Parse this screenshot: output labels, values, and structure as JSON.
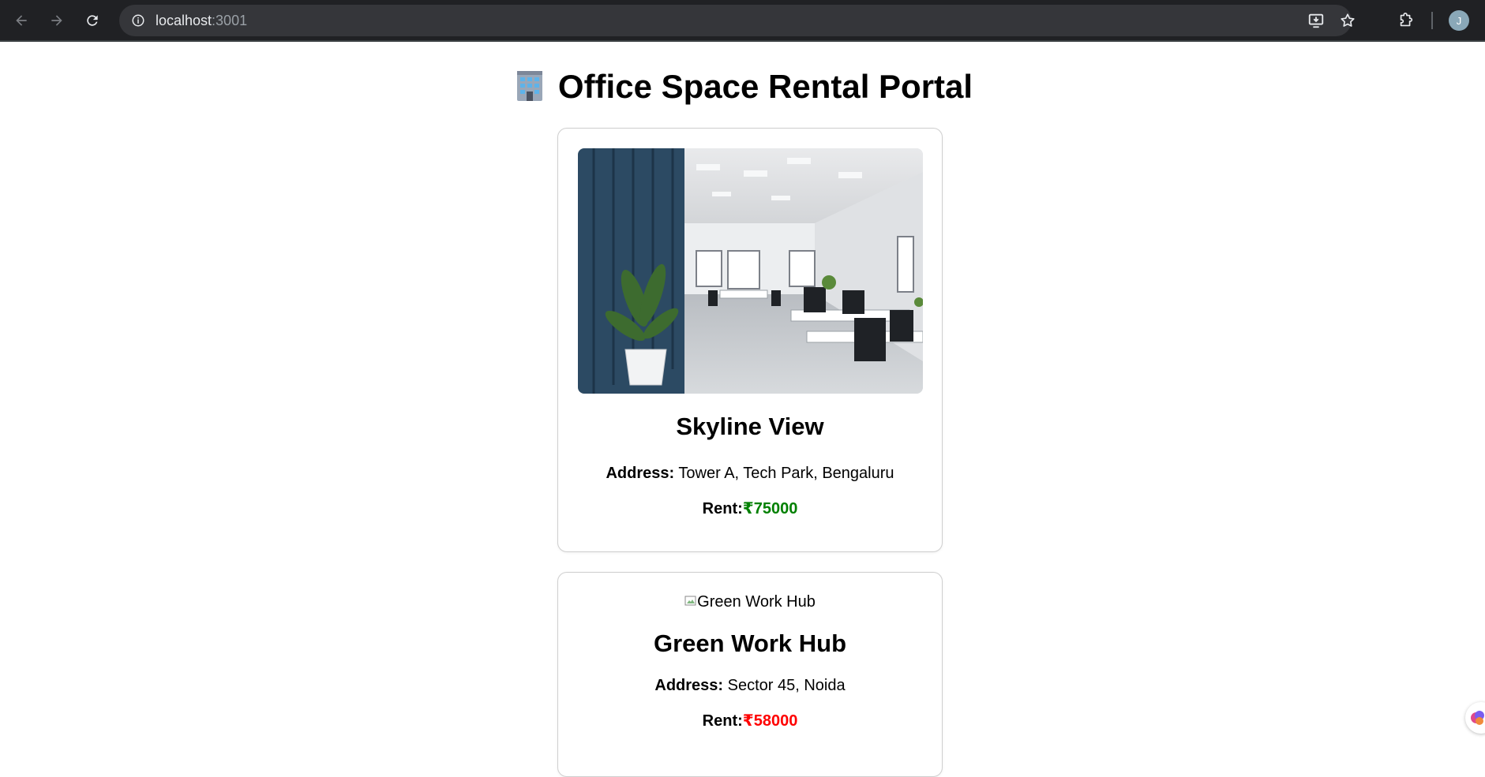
{
  "browser": {
    "url_host": "localhost",
    "url_port": ":3001",
    "profile_initial": "J"
  },
  "page": {
    "title": "Office Space Rental Portal",
    "title_emoji": "office-building-emoji"
  },
  "offices": [
    {
      "name": "Skyline View",
      "address_label": "Address:",
      "address": "Tower A, Tech Park, Bengaluru",
      "rent_label": "Rent:",
      "rent": "₹75000",
      "rent_color": "#008000",
      "image_alt": ""
    },
    {
      "name": "Green Work Hub",
      "address_label": "Address:",
      "address": "Sector 45, Noida",
      "rent_label": "Rent:",
      "rent": "₹58000",
      "rent_color": "#ff0000",
      "image_alt": "Green Work Hub"
    }
  ],
  "colors": {
    "chrome_bg": "#202124",
    "omnibox_bg": "#35363a",
    "rent_low": "#008000",
    "rent_high": "#ff0000"
  }
}
